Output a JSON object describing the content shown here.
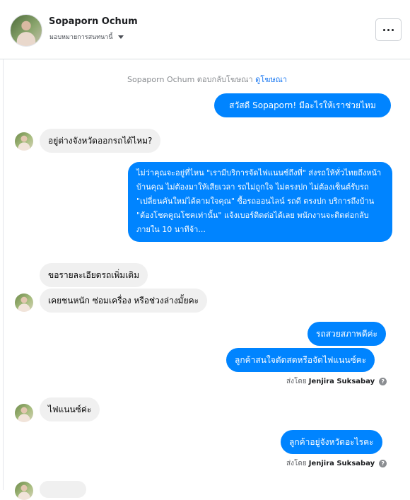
{
  "header": {
    "name": "Sopaporn Ochum",
    "subtitle": "มอบหมายการสนทนานี้"
  },
  "thread": {
    "system_note": {
      "text": "Sopaporn Ochum ตอบกลับโฆษณา",
      "link": "ดูโฆษณา"
    },
    "messages": [
      {
        "text": "สวัสดี Sopaporn! มีอะไรให้เราช่วยไหม"
      },
      {
        "text": "อยู่ต่างจังหวัดออกรถได้ไหม?"
      },
      {
        "text": "ไม่ว่าคุณจะอยู่ที่ไหน \"เรามีบริการจัดไฟแนนซ์ถึงที่\"  ส่งรถให้ทั่วไทยถึงหน้าบ้านคุณ ไม่ต้องมาให้เสียเวลา รถไม่ถูกใจ ไม่ตรงปก ไม่ต้องเซ็นต์รับรถ \"เปลี่ยนคันใหม่ได้ตามใจคุณ\" ซื้อรถออนไลน์ รถดี ตรงปก บริการถึงบ้าน \"ต้องโชคคูณโชคเท่านั้น\" แจ้งเบอร์ติดต่อได้เลย พนักงานจะติดต่อกลับภายใน 10 นาทีจ้า..."
      },
      {
        "text": "ขอรายละเอียดรถเพิ่มเติม"
      },
      {
        "text": "เคยชนหนัก ซ่อมเครื่อง หรือช่วงล่างมั้ยคะ"
      },
      {
        "text": "รถสวยสภาพดีค่ะ"
      },
      {
        "text": "ลูกค้าสนใจตัดสดหรือจัดไฟแนนซ์คะ"
      },
      {
        "text": "ไฟแนนซ์ค่ะ"
      },
      {
        "text": "ลูกค้าอยู่จังหวัดอะไรคะ"
      }
    ],
    "sent_by": {
      "prefix": "ส่งโดย",
      "agent": "Jenjira Suksabay"
    }
  }
}
